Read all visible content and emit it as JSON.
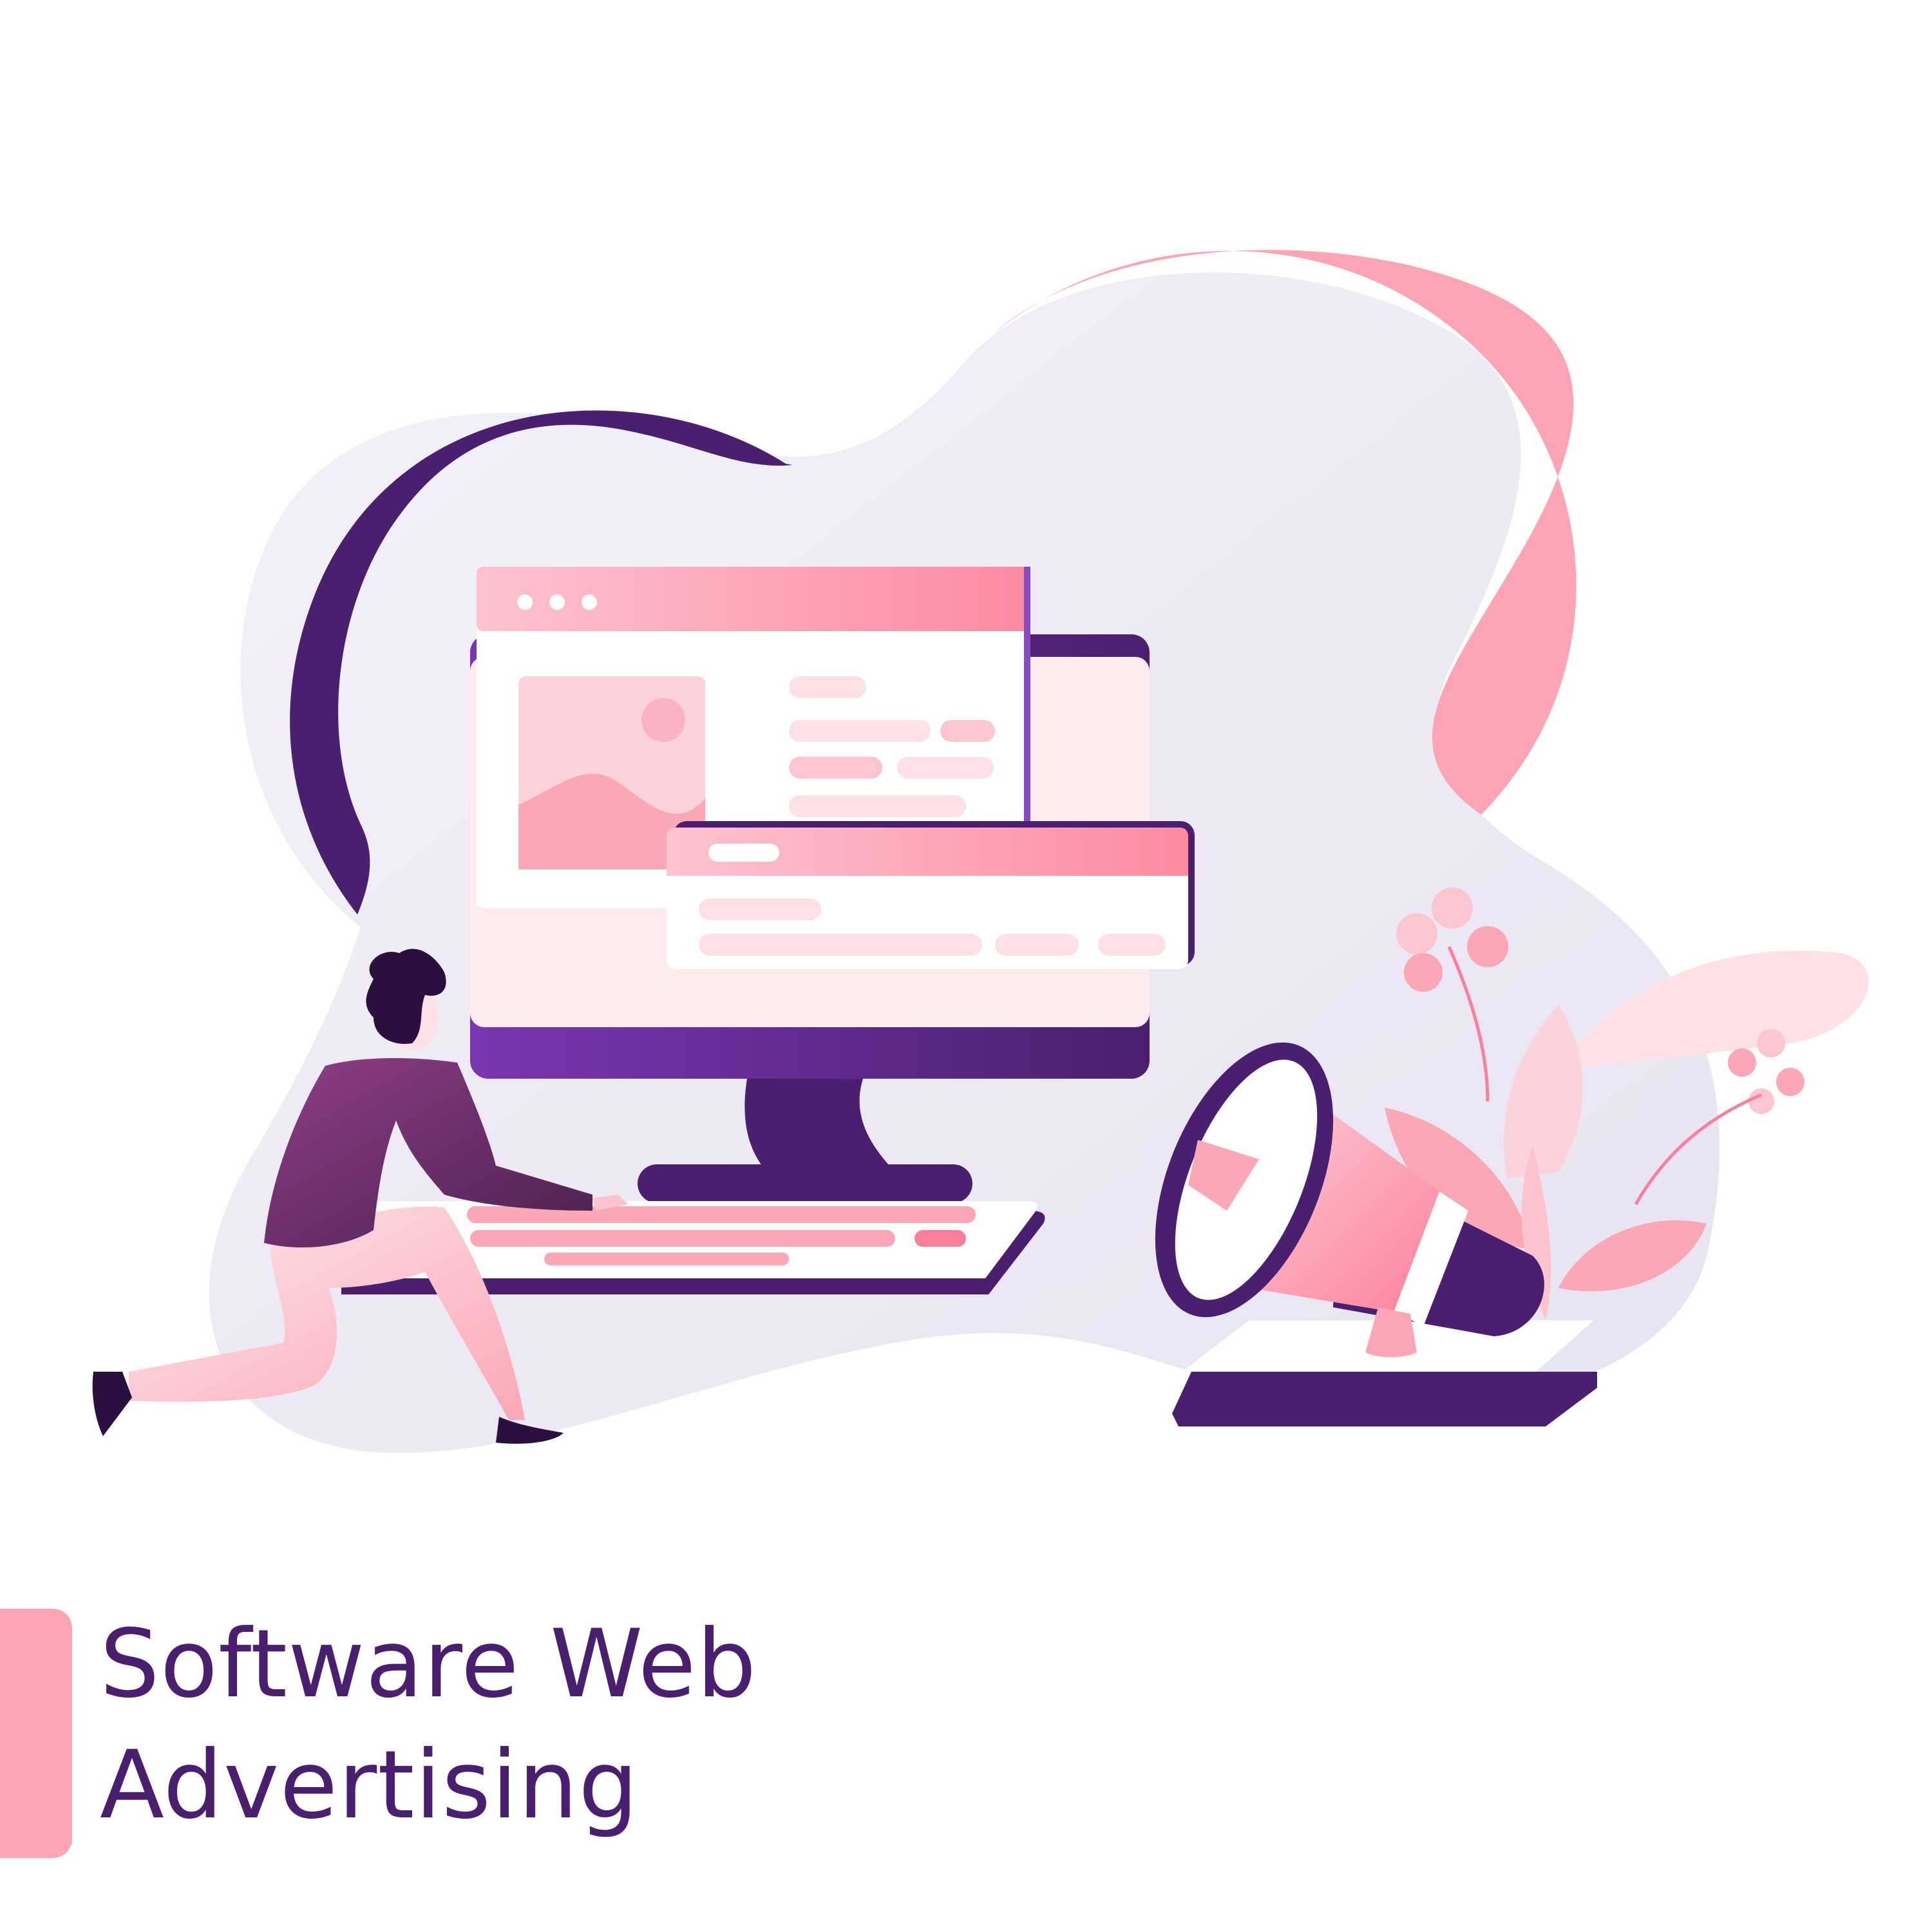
{
  "title": {
    "line1": "Software Web",
    "line2": "Advertising"
  },
  "colors": {
    "purple_dark": "#4b1f6f",
    "purple_mid": "#7a36b1",
    "pink": "#fda4b5",
    "pink_light": "#fde1e6",
    "blob_bg": "#eeebf6",
    "white": "#ffffff"
  },
  "illustration": {
    "icons": [
      "person-icon",
      "desktop-monitor-icon",
      "browser-window-icon",
      "keyboard-icon",
      "megaphone-icon",
      "smartphone-icon",
      "plant-leaves-icon",
      "flower-icon"
    ]
  }
}
